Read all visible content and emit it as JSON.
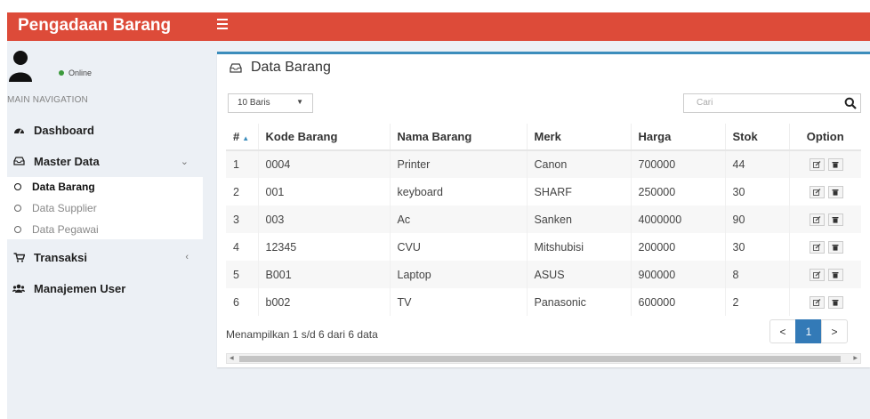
{
  "app": {
    "title": "Pengadaan Barang"
  },
  "user": {
    "status": "Online"
  },
  "nav": {
    "header": "MAIN NAVIGATION",
    "items": [
      {
        "label": "Dashboard",
        "icon": "dashboard-icon"
      },
      {
        "label": "Master Data",
        "icon": "inbox-icon",
        "caret": "⌄"
      },
      {
        "label": "Transaksi",
        "icon": "cart-icon",
        "caret": "‹"
      },
      {
        "label": "Manajemen User",
        "icon": "users-icon"
      }
    ],
    "submenu": [
      {
        "label": "Data Barang",
        "active": true
      },
      {
        "label": "Data Supplier",
        "active": false
      },
      {
        "label": "Data Pegawai",
        "active": false
      }
    ]
  },
  "main": {
    "title": "Data Barang",
    "length_select": "10 Baris",
    "search_placeholder": "Cari",
    "columns": [
      "#",
      "Kode Barang",
      "Nama Barang",
      "Merk",
      "Harga",
      "Stok",
      "Option"
    ],
    "rows": [
      [
        "1",
        "0004",
        "Printer",
        "Canon",
        "700000",
        "44"
      ],
      [
        "2",
        "001",
        "keyboard",
        "SHARF",
        "250000",
        "30"
      ],
      [
        "3",
        "003",
        "Ac",
        "Sanken",
        "4000000",
        "90"
      ],
      [
        "4",
        "12345",
        "CVU",
        "Mitshubisi",
        "200000",
        "30"
      ],
      [
        "5",
        "B001",
        "Laptop",
        "ASUS",
        "900000",
        "8"
      ],
      [
        "6",
        "b002",
        "TV",
        "Panasonic",
        "600000",
        "2"
      ]
    ],
    "info": "Menampilkan 1 s/d 6 dari 6 data",
    "pagination": {
      "prev": "<",
      "current": "1",
      "next": ">"
    }
  },
  "colors": {
    "header_bg": "#dd4b39",
    "box_accent": "#3c8dbc",
    "page_active": "#337ab7",
    "sidebar_bg": "#ecf0f5"
  }
}
